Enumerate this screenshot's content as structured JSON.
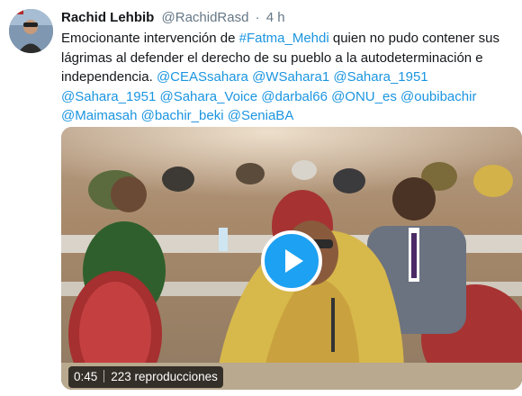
{
  "tweet": {
    "display_name": "Rachid Lehbib",
    "handle": "@RachidRasd",
    "separator": "·",
    "time": "4 h",
    "text_intro": "Emocionante intervención de ",
    "hashtag": "#Fatma_Mehdi",
    "text_body": " quien no pudo contener sus lágrimas al defender el derecho de su pueblo a la autodeterminación e independencia. ",
    "mentions": [
      "@CEASsahara",
      "@WSahara1",
      "@Sahara_1951",
      "@Sahara_1951",
      "@Sahara_Voice",
      "@darbal66",
      "@ONU_es",
      "@oubibachir",
      "@Maimasah",
      "@bachir_beki",
      "@SeniaBA"
    ]
  },
  "video": {
    "duration": "0:45",
    "views": "223 reproducciones",
    "play_icon": "play-icon"
  },
  "colors": {
    "link": "#1b95e0",
    "play_button": "#1da1f2",
    "text": "#14171a",
    "secondary": "#657786"
  }
}
